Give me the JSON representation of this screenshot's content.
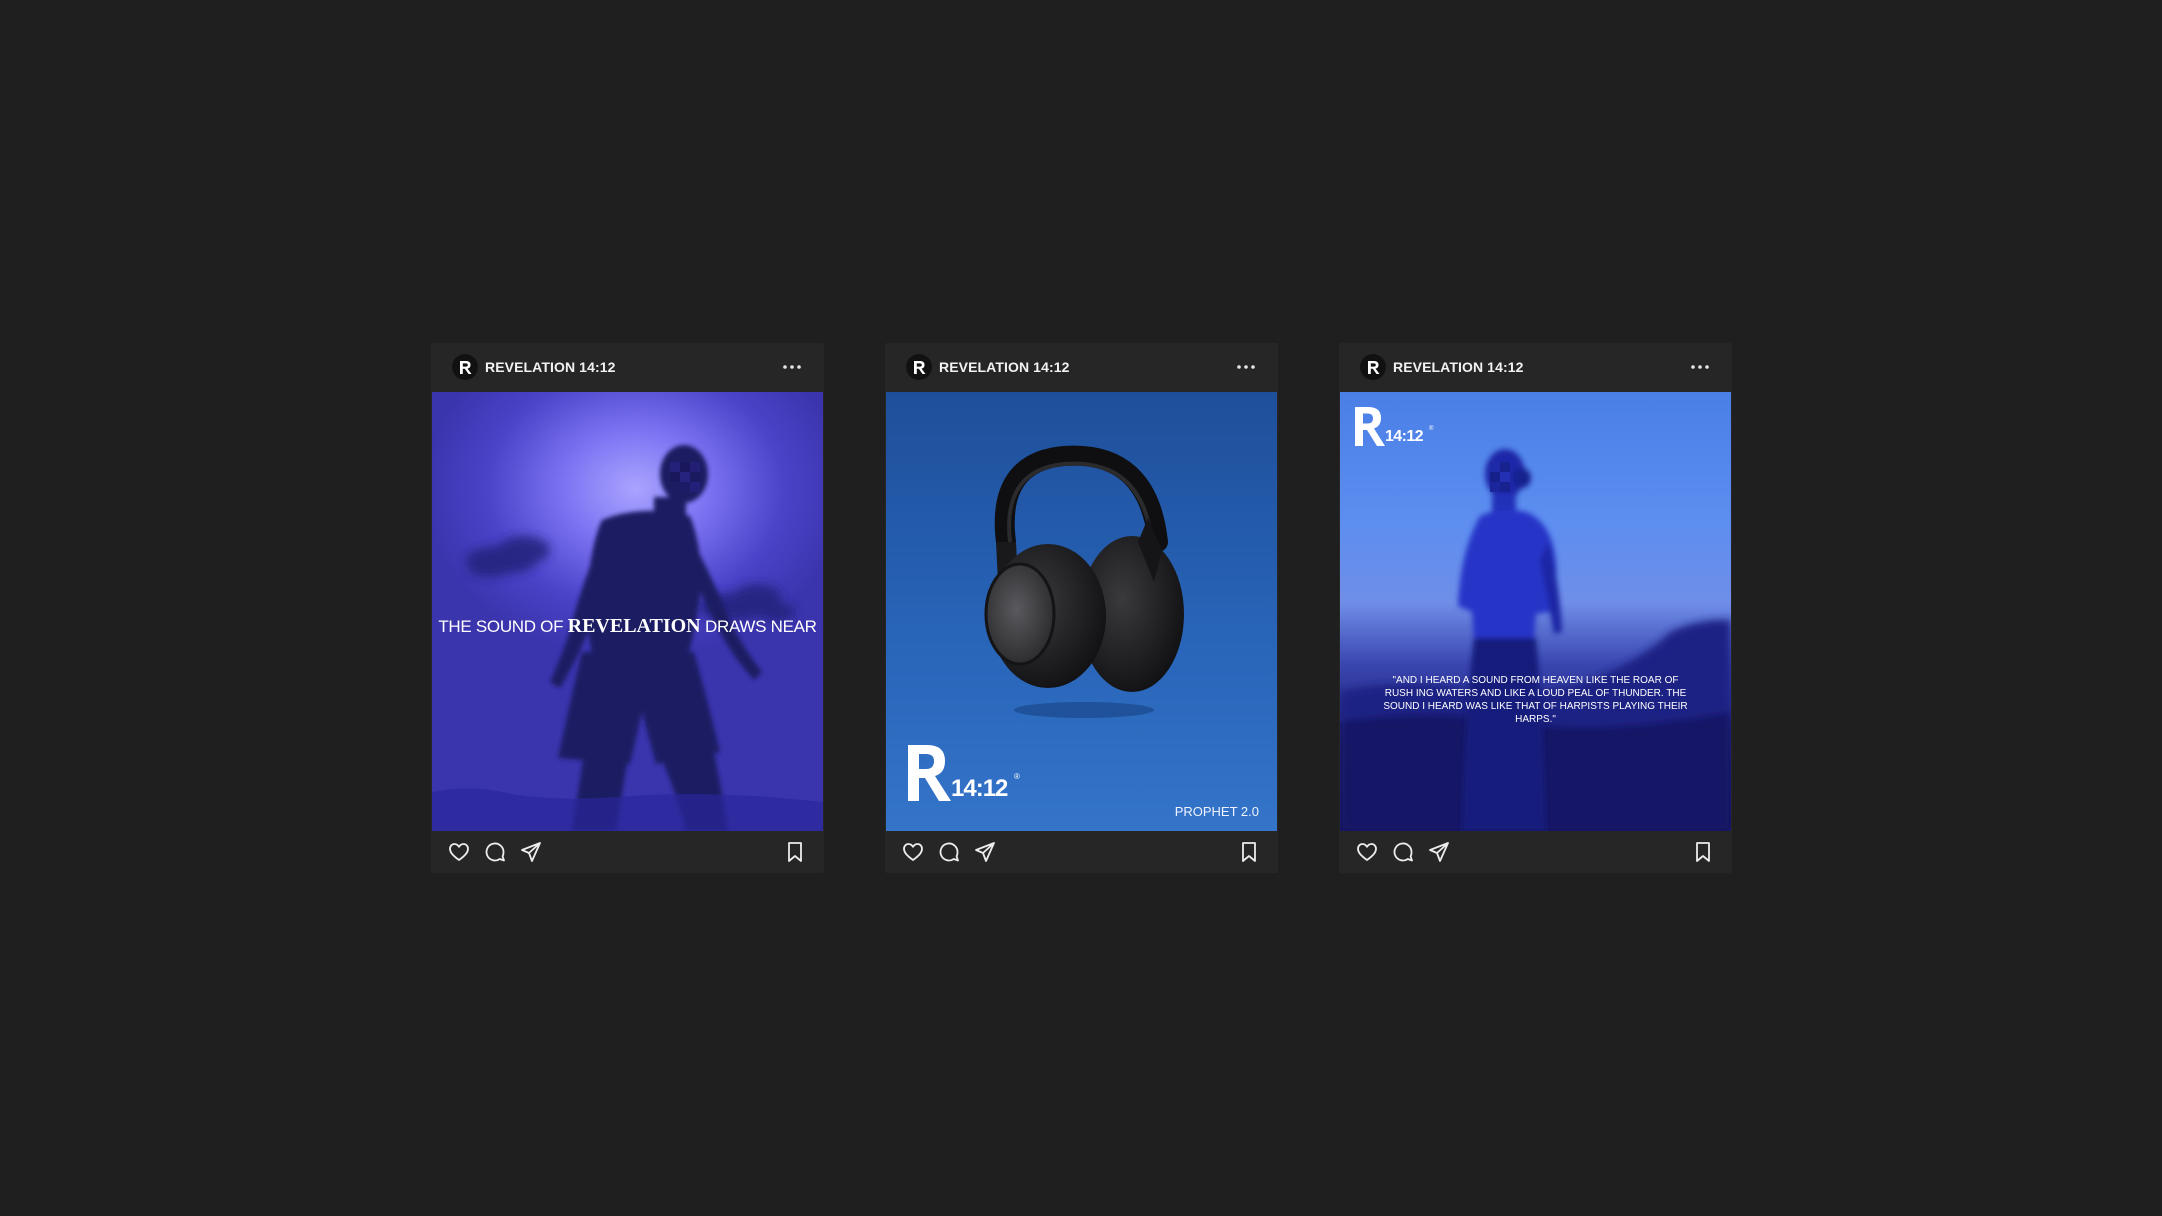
{
  "posts": [
    {
      "account": "REVELATION 14:12",
      "caption_before": "THE SOUND OF ",
      "caption_highlight": "REVELATION",
      "caption_after": " DRAWS NEAR"
    },
    {
      "account": "REVELATION 14:12",
      "logo_text": "14:12",
      "product": "PROPHET 2.0"
    },
    {
      "account": "REVELATION 14:12",
      "logo_text": "14:12",
      "quote": "\"AND I HEARD A SOUND FROM HEAVEN LIKE THE ROAR OF RUSH ING WATERS AND LIKE A LOUD PEAL OF THUNDER. THE SOUND I HEARD WAS LIKE THAT OF HARPISTS PLAYING THEIR HARPS.\""
    }
  ],
  "icons": {
    "avatar": "r-logo-icon",
    "menu": "more-horizontal-icon",
    "like": "heart-icon",
    "comment": "comment-icon",
    "share": "paper-plane-icon",
    "save": "bookmark-icon"
  },
  "colors": {
    "background": "#1f1f1f",
    "card": "#262626",
    "post1_accent": "#5a52e0",
    "post2_accent": "#2864b8",
    "post3_accent": "#4a7fe6"
  }
}
